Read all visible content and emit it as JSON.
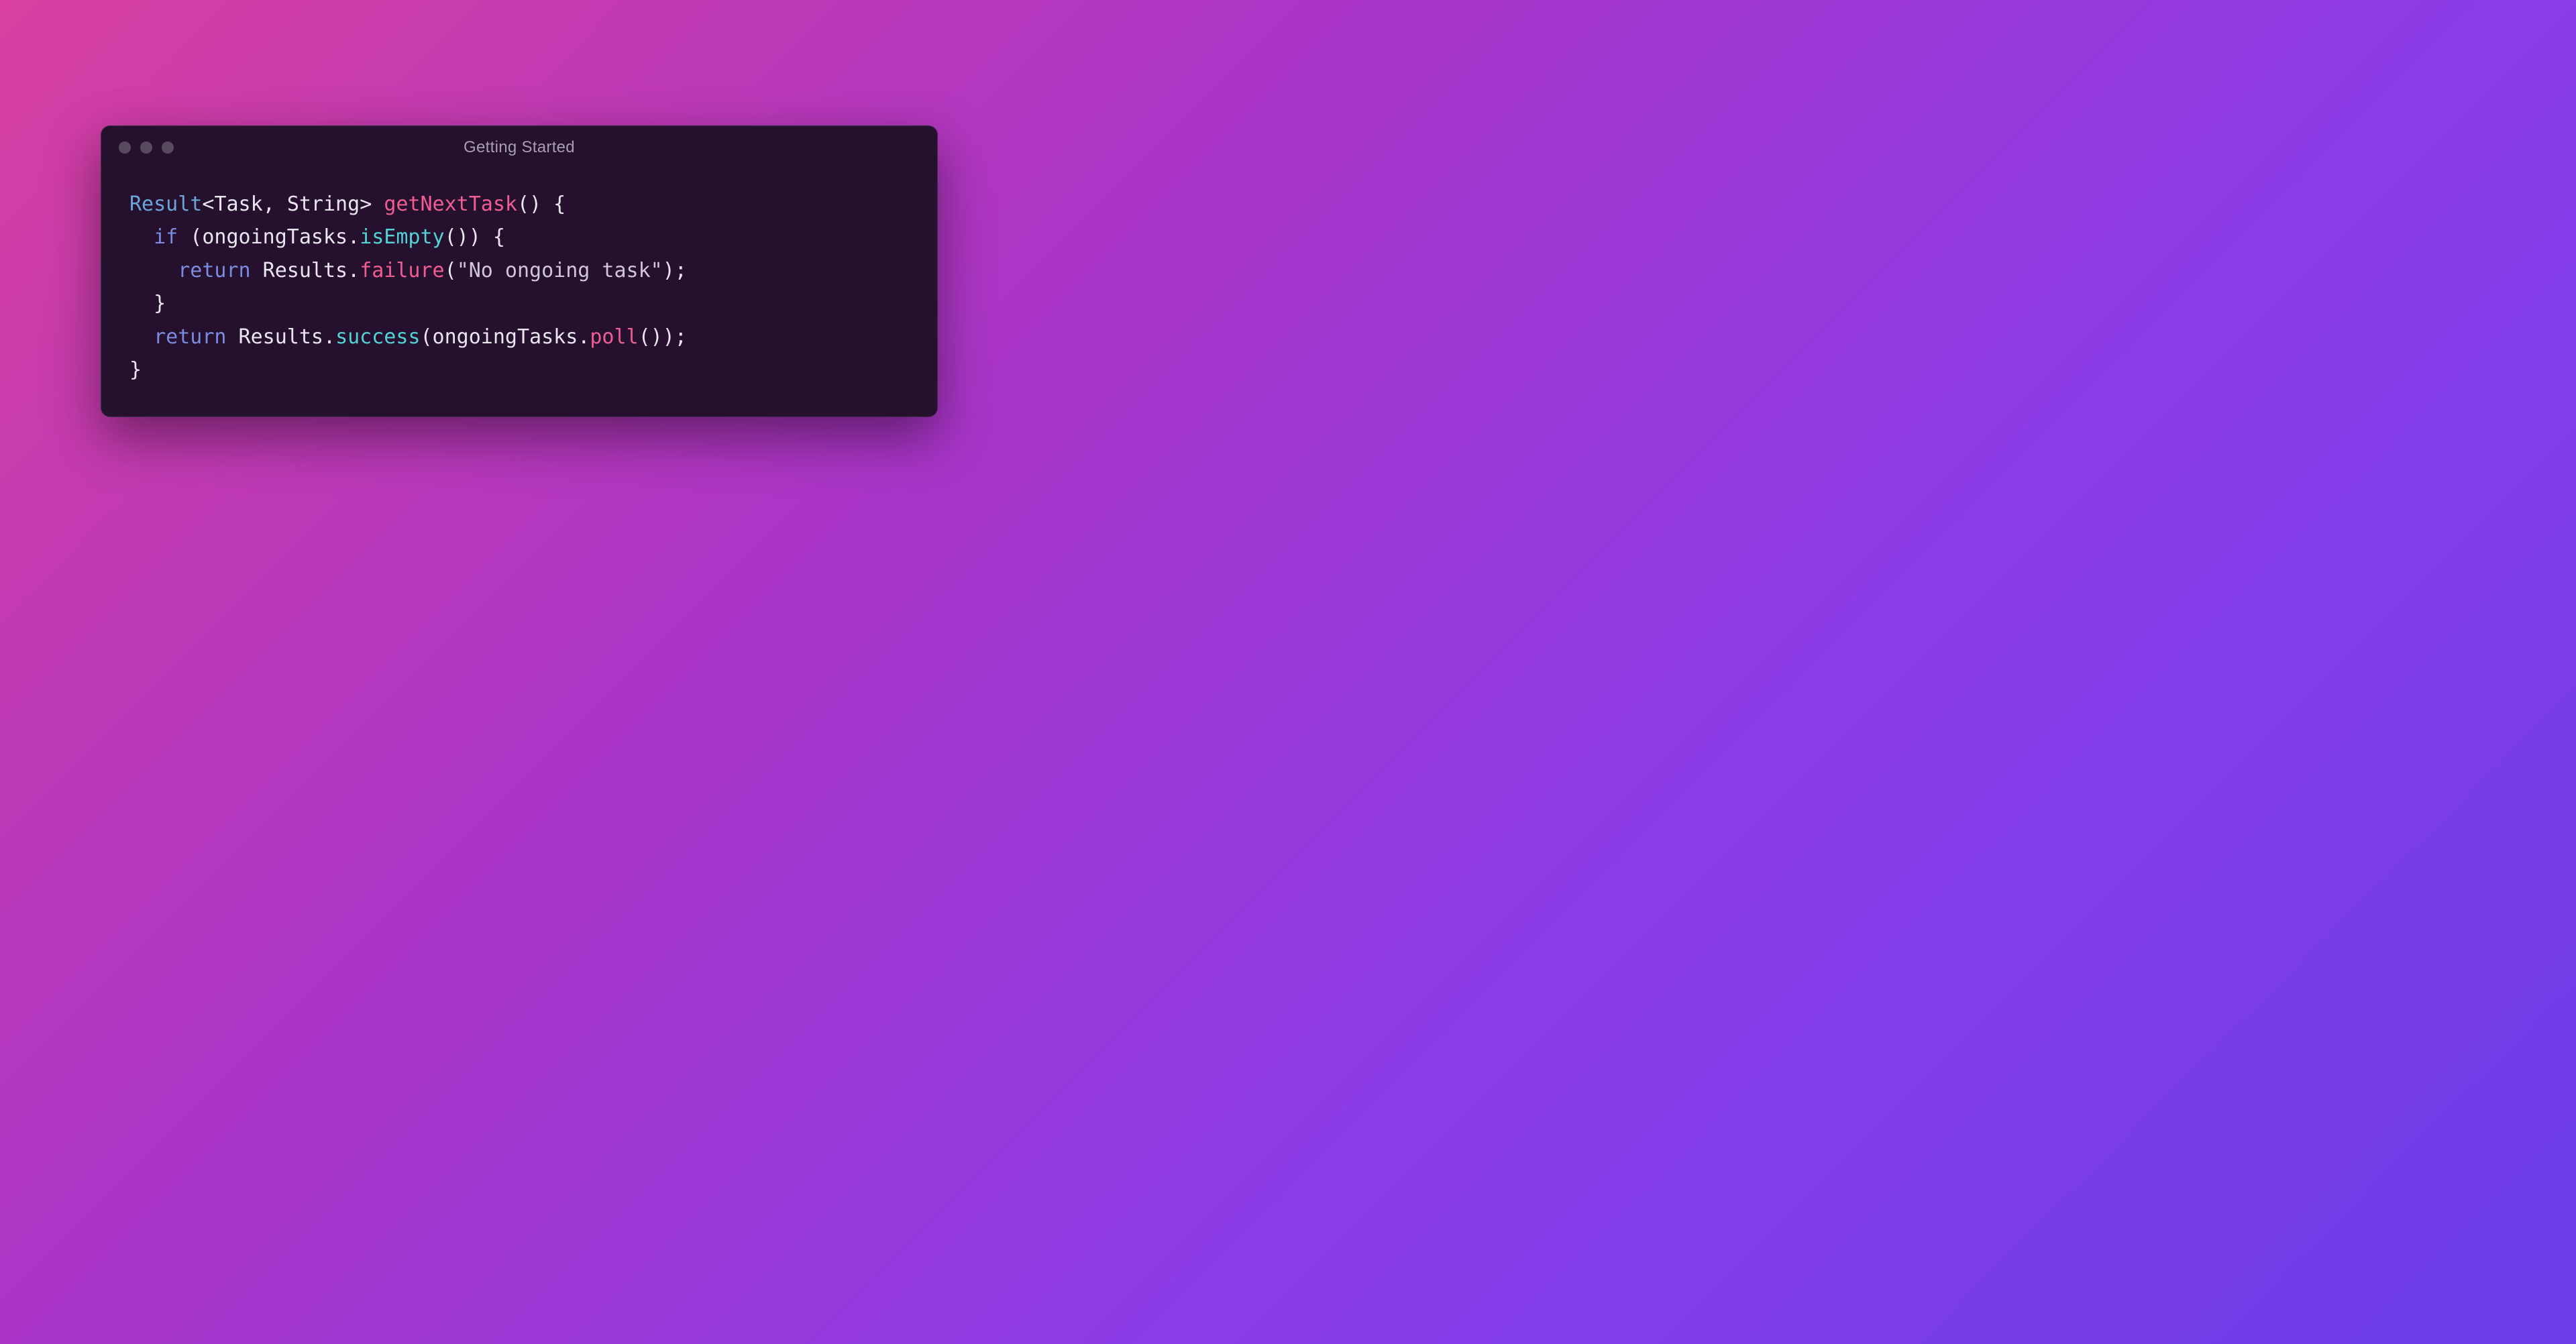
{
  "window": {
    "title": "Getting Started"
  },
  "code": {
    "tokens": [
      [
        {
          "t": "Result",
          "c": "tok-type"
        },
        {
          "t": "<",
          "c": "tok-punct"
        },
        {
          "t": "Task",
          "c": "tok-ident"
        },
        {
          "t": ", ",
          "c": "tok-punct"
        },
        {
          "t": "String",
          "c": "tok-ident"
        },
        {
          "t": "> ",
          "c": "tok-punct"
        },
        {
          "t": "getNextTask",
          "c": "tok-method"
        },
        {
          "t": "() {",
          "c": "tok-punct"
        }
      ],
      [
        {
          "t": "  ",
          "c": "tok-punct"
        },
        {
          "t": "if",
          "c": "tok-kw"
        },
        {
          "t": " (ongoingTasks.",
          "c": "tok-punct"
        },
        {
          "t": "isEmpty",
          "c": "tok-call"
        },
        {
          "t": "()) {",
          "c": "tok-punct"
        }
      ],
      [
        {
          "t": "    ",
          "c": "tok-punct"
        },
        {
          "t": "return",
          "c": "tok-kw"
        },
        {
          "t": " Results.",
          "c": "tok-punct"
        },
        {
          "t": "failure",
          "c": "tok-method"
        },
        {
          "t": "(",
          "c": "tok-punct"
        },
        {
          "t": "\"No ongoing task\"",
          "c": "tok-str"
        },
        {
          "t": ");",
          "c": "tok-punct"
        }
      ],
      [
        {
          "t": "  }",
          "c": "tok-punct"
        }
      ],
      [
        {
          "t": "  ",
          "c": "tok-punct"
        },
        {
          "t": "return",
          "c": "tok-kw"
        },
        {
          "t": " Results.",
          "c": "tok-punct"
        },
        {
          "t": "success",
          "c": "tok-call"
        },
        {
          "t": "(ongoingTasks.",
          "c": "tok-punct"
        },
        {
          "t": "poll",
          "c": "tok-method"
        },
        {
          "t": "());",
          "c": "tok-punct"
        }
      ],
      [
        {
          "t": "}",
          "c": "tok-punct"
        }
      ]
    ]
  }
}
